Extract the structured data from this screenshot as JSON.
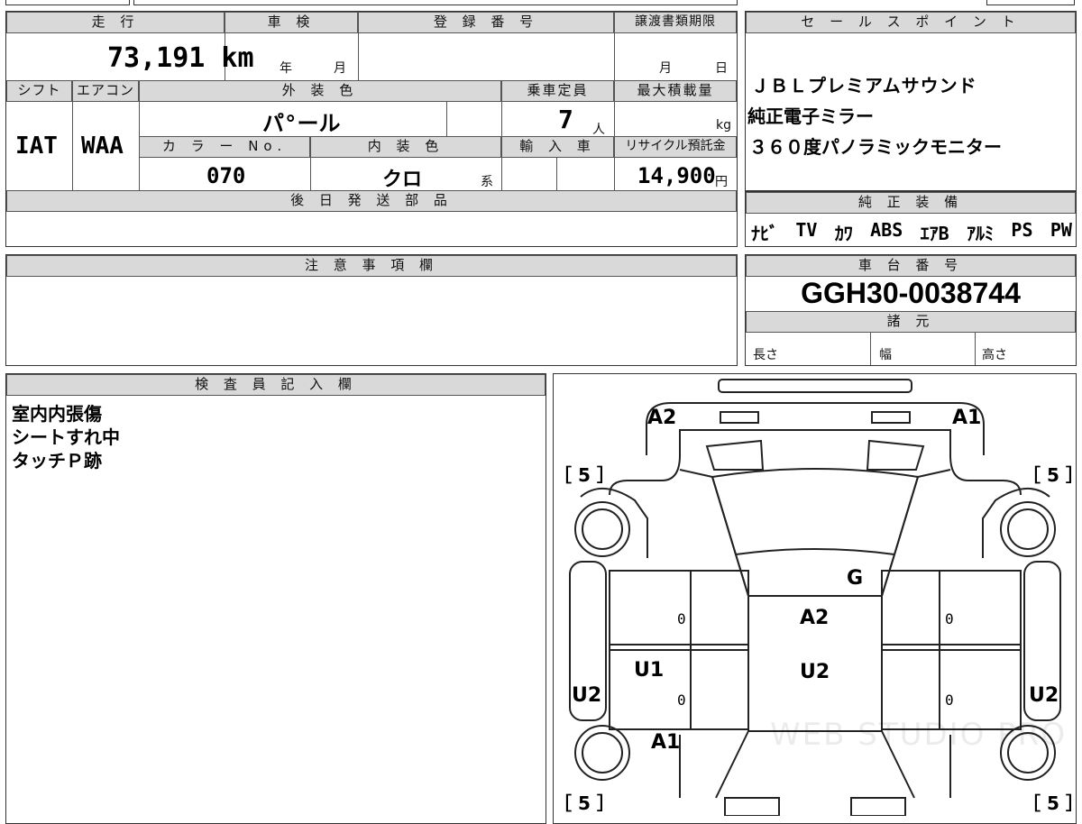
{
  "top_sheet": {
    "headers": {
      "mileage": "走 行",
      "inspection": "車 検",
      "registration": "登 録 番 号",
      "transfer_deadline": "譲渡書類期限",
      "shift": "シフト",
      "aircon": "エアコン",
      "exterior_color": "外 装 色",
      "capacity": "乗車定員",
      "max_load": "最大積載量",
      "color_no": "カ ラ ー No.",
      "interior_color": "内 装 色",
      "import": "輸 入 車",
      "recycle": "リサイクル預託金",
      "later_parts": "後 日 発 送 部 品"
    },
    "mileage_value": "73,191 km",
    "inspection_year_unit": "年",
    "inspection_month_unit": "月",
    "transfer_month_unit": "月",
    "transfer_day_unit": "日",
    "shift_value": "IAT",
    "aircon_value": "WAA",
    "exterior_color_value": "パ°ール",
    "capacity_value": "7",
    "capacity_unit": "人",
    "max_load_unit": "kg",
    "color_no_value": "070",
    "interior_color_value": "クロ",
    "interior_color_suffix": "系",
    "recycle_value": "14,900",
    "recycle_unit": "円"
  },
  "sales_points": {
    "header": "セ ー ル ス ポ イ ン ト",
    "lines": [
      "ＪＢＬプレミアムサウンド",
      "純正電子ミラー",
      "３６０度パノラミックモニター"
    ]
  },
  "equipment": {
    "header": "純 正 装 備",
    "items": [
      "ﾅﾋﾞ",
      "TV",
      "ｶﾜ",
      "ABS",
      "ｴｱB",
      "ｱﾙﾐ",
      "PS",
      "PW"
    ]
  },
  "caution": {
    "header": "注 意 事 項 欄"
  },
  "chassis": {
    "header": "車 台 番 号",
    "number": "GGH30-0038744"
  },
  "specs": {
    "header": "諸 元",
    "length": "長さ",
    "width": "幅",
    "height": "高さ"
  },
  "inspector": {
    "header": "検 査 員 記 入 欄",
    "notes": [
      "室内内張傷",
      "シートすれ中",
      "タッチＰ跡"
    ]
  },
  "diagram": {
    "labels": {
      "front_left": "A2",
      "front_right": "A1",
      "tread_fl": "［ 5 ］",
      "tread_fr": "［ 5 ］",
      "tread_rl": "［ 5 ］",
      "tread_rr": "［ 5 ］",
      "windshield": "G",
      "roof": "A2",
      "roof_rear": "U2",
      "left_front_door": "U1",
      "left_rear_quarter": "A1",
      "left_side": "U2",
      "right_side": "U2",
      "zero1": "0",
      "zero2": "0",
      "zero3": "0",
      "zero4": "0"
    },
    "watermark": "WEB STUDIO PRO"
  }
}
